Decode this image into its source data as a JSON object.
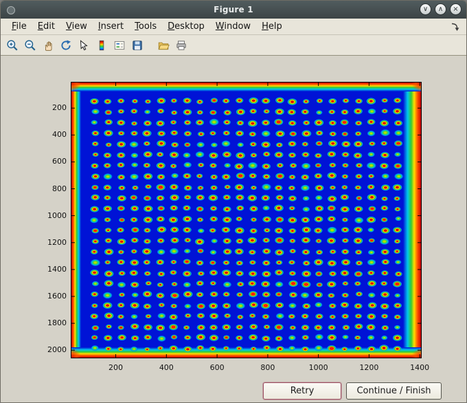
{
  "window": {
    "title": "Figure 1",
    "controls": [
      {
        "name": "minimize",
        "glyph": "∨"
      },
      {
        "name": "maximize",
        "glyph": "∧"
      },
      {
        "name": "close",
        "glyph": "×"
      }
    ]
  },
  "menu_bar": {
    "items": [
      "File",
      "Edit",
      "View",
      "Insert",
      "Tools",
      "Desktop",
      "Window",
      "Help"
    ]
  },
  "toolbar": {
    "icons": [
      "zoom-in",
      "zoom-out",
      "pan-hand",
      "rotate-3d",
      "data-cursor",
      "insert-colorbar",
      "insert-legend",
      "save-figure",
      "open-file",
      "print-figure"
    ]
  },
  "figure": {
    "buttons": [
      {
        "label": "Retry"
      },
      {
        "label": "Continue / Finish"
      }
    ]
  },
  "chart_data": {
    "type": "heatmap",
    "title": "",
    "xlabel": "",
    "ylabel": "",
    "description": "Microarray plate scan shown with jet colormap: deep blue background, 24x24 grid of red/orange hybridization spots (some weaker green/cyan spots), saturated red-orange bands along all four plate edges",
    "colormap": "jet",
    "x_ticks": [
      200,
      400,
      600,
      800,
      1000,
      1200,
      1400
    ],
    "y_ticks": [
      200,
      400,
      600,
      800,
      1000,
      1200,
      1400,
      1600,
      1800,
      2000
    ],
    "x_range": [
      25,
      1405
    ],
    "y_range": [
      10,
      2055
    ],
    "background_color": "#0013d6",
    "tick_color": "#000000",
    "corner_color": "#d81000",
    "edge_gradient": {
      "stops_inner_to_outer": [
        "#0013d6",
        "#00c8ee",
        "#33cc33",
        "#ffdd00",
        "#ff5500",
        "#c80000"
      ],
      "offsets": [
        0,
        0.25,
        0.45,
        0.62,
        0.8,
        1
      ],
      "left_width": 14,
      "right_width": 26,
      "top_height": 13,
      "bottom_height": 15
    },
    "spot_grid": {
      "cols": 24,
      "rows": 24,
      "x_first": 118,
      "x_step": 52,
      "y_first": 148,
      "y_step": 80,
      "spot_rx": 15,
      "spot_ry": 20,
      "weak_fraction": 0.13
    },
    "spot_colors_strong": [
      "#00b4e6",
      "#55d020",
      "#ffc800",
      "#e00000"
    ],
    "spot_colors_weak": [
      "#0080f0",
      "#00c8c8",
      "#44d044",
      "#b4e000"
    ]
  }
}
